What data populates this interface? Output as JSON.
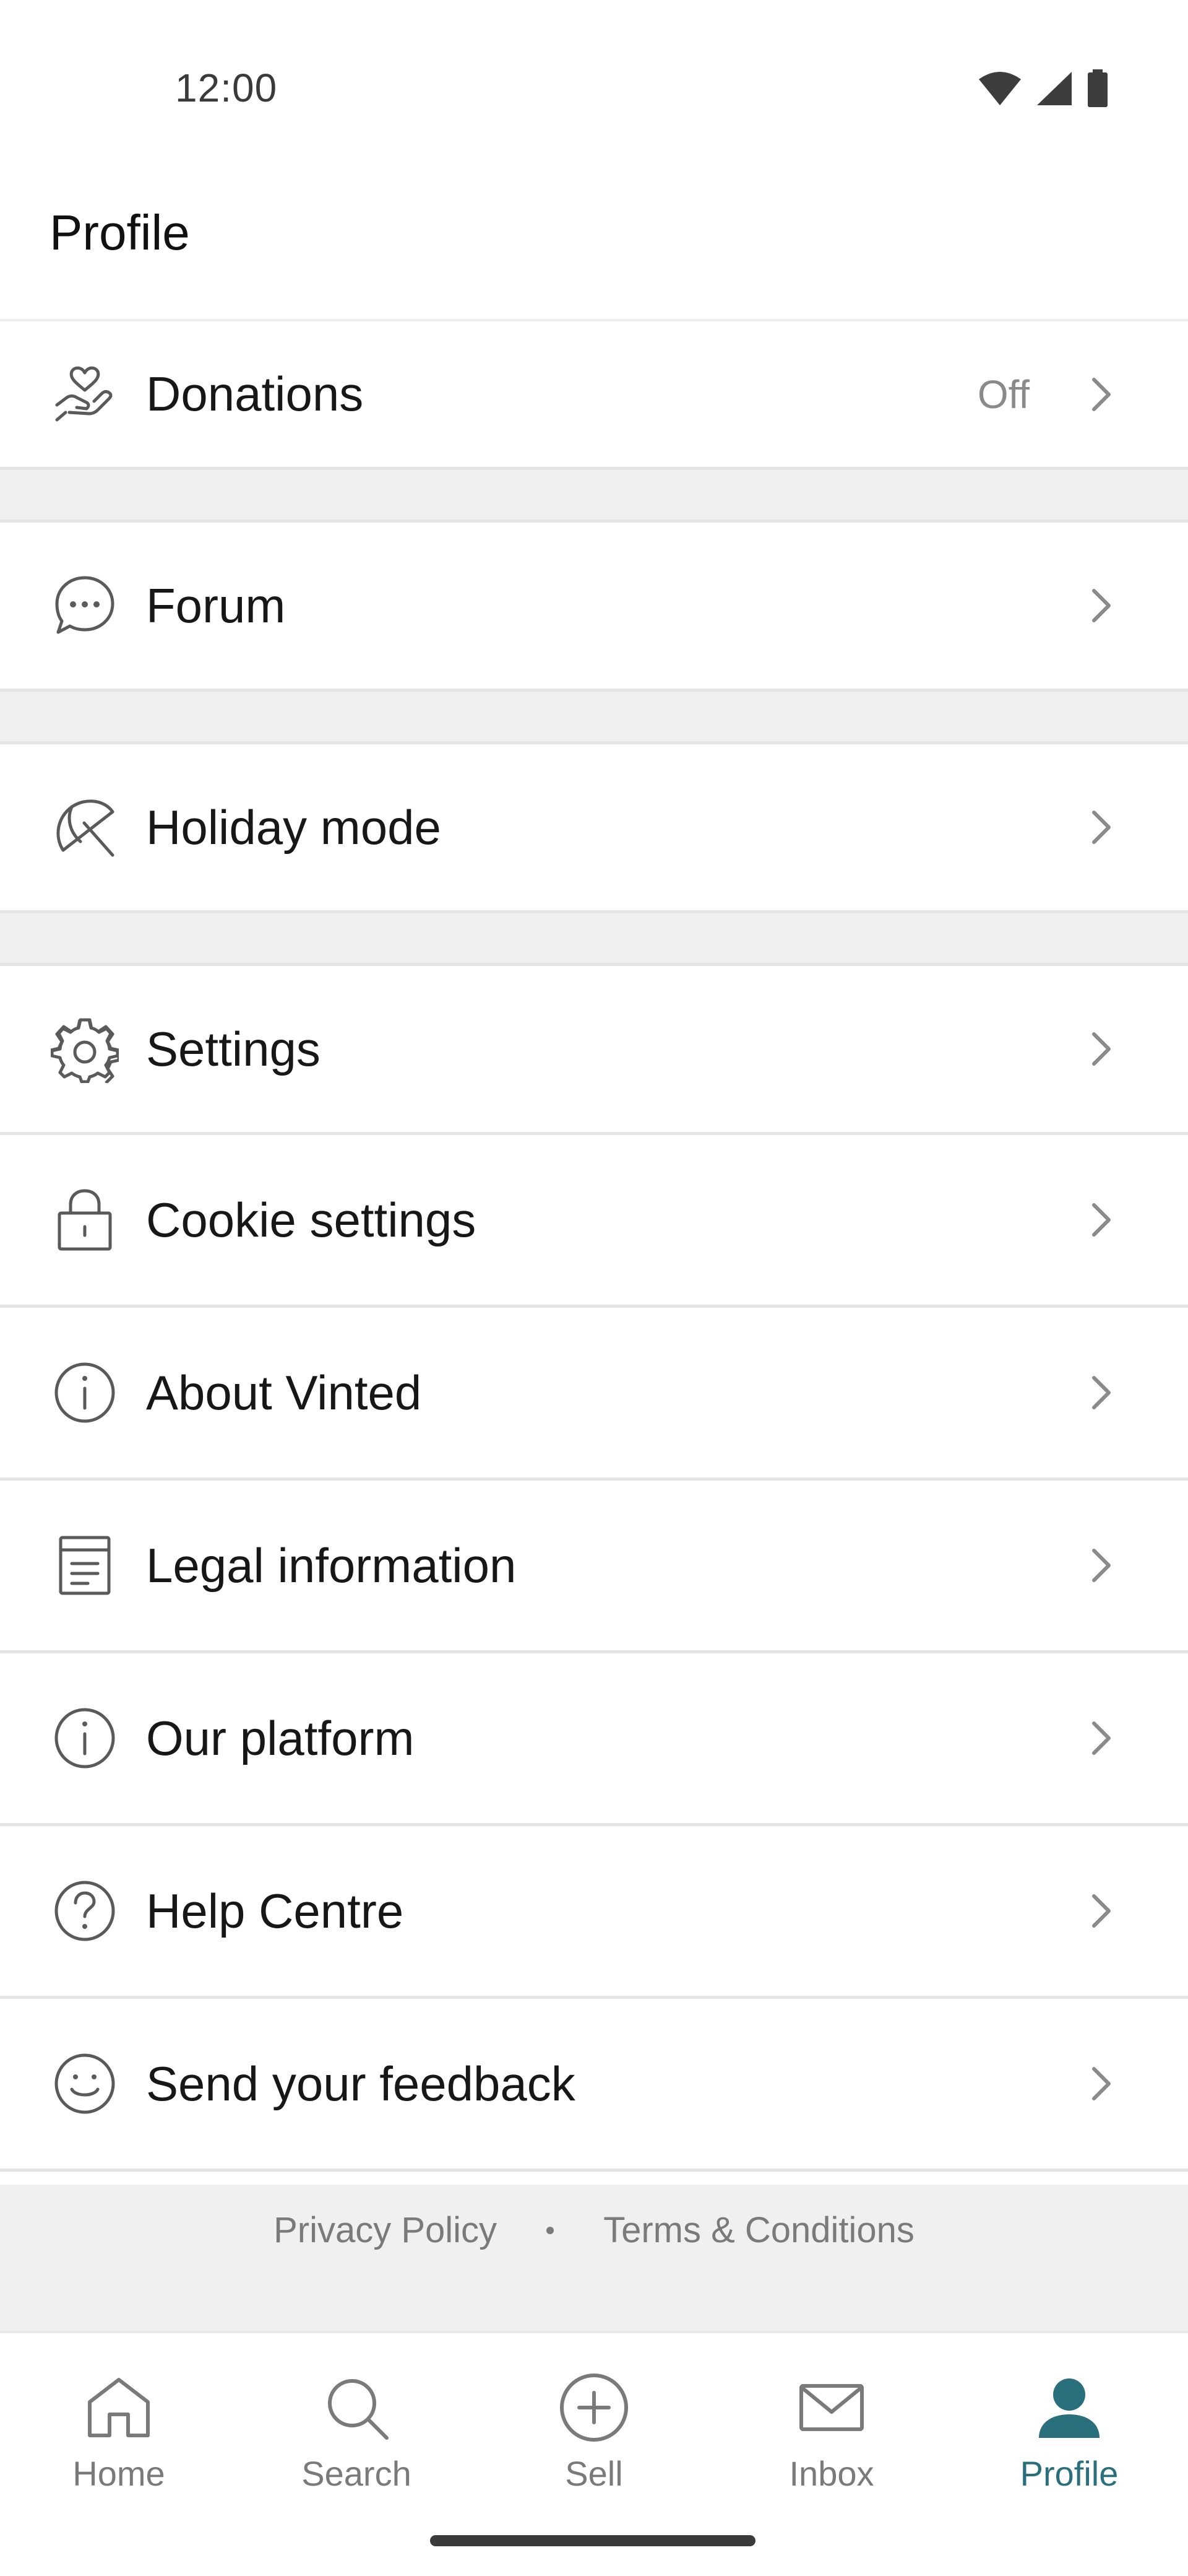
{
  "status_bar": {
    "time": "12:00",
    "icons": [
      "wifi-icon",
      "signal-icon",
      "battery-icon"
    ]
  },
  "header": {
    "title": "Profile"
  },
  "menu": {
    "items": [
      {
        "label": "Donations",
        "value": "Off",
        "icon": "hand-heart-icon"
      },
      {
        "label": "Forum",
        "icon": "chat-bubble-icon"
      },
      {
        "label": "Holiday mode",
        "icon": "umbrella-icon"
      },
      {
        "label": "Settings",
        "icon": "gear-icon"
      },
      {
        "label": "Cookie settings",
        "icon": "lock-icon"
      },
      {
        "label": "About Vinted",
        "icon": "info-icon"
      },
      {
        "label": "Legal information",
        "icon": "document-icon"
      },
      {
        "label": "Our platform",
        "icon": "info-icon"
      },
      {
        "label": "Help Centre",
        "icon": "question-icon"
      },
      {
        "label": "Send your feedback",
        "icon": "smiley-icon"
      }
    ]
  },
  "footer": {
    "privacy_label": "Privacy Policy",
    "terms_label": "Terms & Conditions"
  },
  "tabbar": {
    "tabs": [
      {
        "label": "Home",
        "icon": "home-icon"
      },
      {
        "label": "Search",
        "icon": "search-icon"
      },
      {
        "label": "Sell",
        "icon": "plus-circle-icon"
      },
      {
        "label": "Inbox",
        "icon": "envelope-icon"
      },
      {
        "label": "Profile",
        "icon": "person-icon",
        "active": true
      }
    ]
  },
  "colors": {
    "accent": "#2a6f7c",
    "text": "#171717",
    "muted": "#7a7a7a",
    "separator": "#f0f0f0"
  }
}
